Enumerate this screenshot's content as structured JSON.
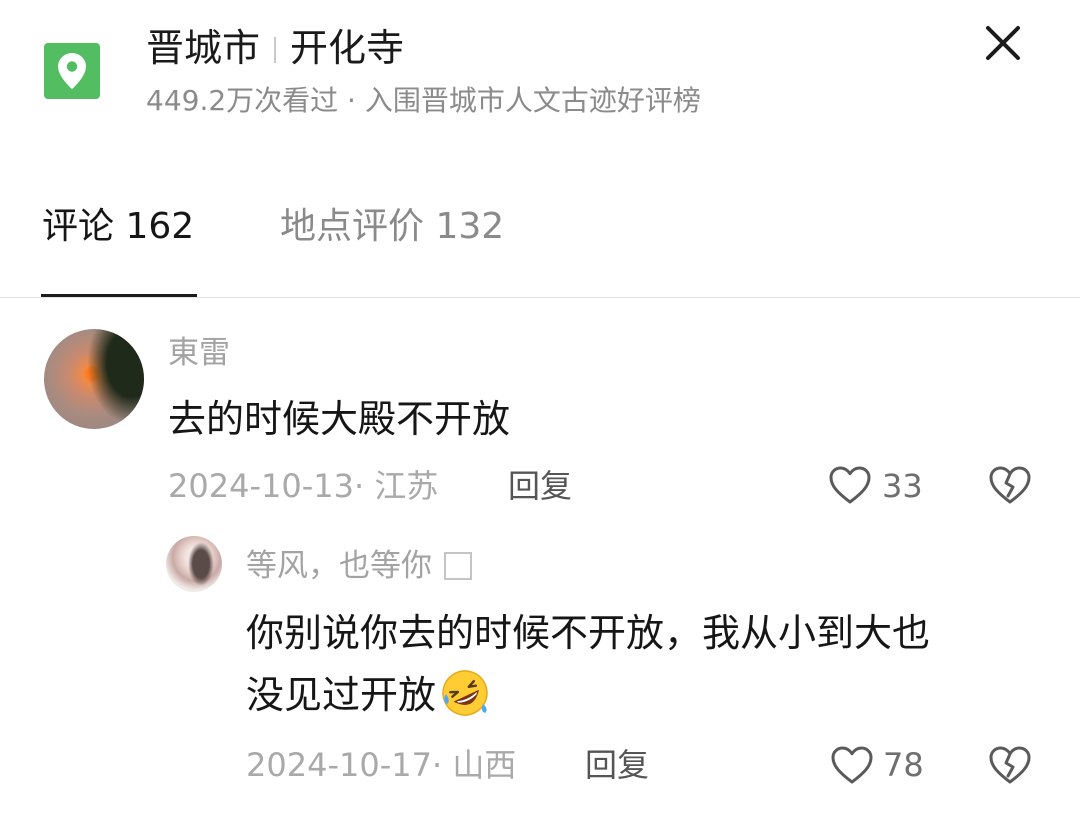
{
  "header": {
    "city": "晋城市",
    "place": "开化寺",
    "subtitle": "449.2万次看过 · 入围晋城市人文古迹好评榜",
    "accent_color": "#53bd62",
    "location_icon": "location-pin-icon",
    "close_icon": "close-icon"
  },
  "tabs": [
    {
      "label": "评论 162",
      "active": true
    },
    {
      "label": "地点评价 132",
      "active": false
    }
  ],
  "comments": [
    {
      "author": "東雷",
      "text": "去的时候大殿不开放",
      "meta": "2024-10-13· 江苏",
      "reply_label": "回复",
      "likes": "33"
    },
    {
      "author": "等风，也等你",
      "text_line1": "你别说你去的时候不开放，我从小到大也",
      "text_line2": "没见过开放",
      "emoji": "rofl-emoji",
      "meta": "2024-10-17· 山西",
      "reply_label": "回复",
      "likes": "78"
    }
  ]
}
